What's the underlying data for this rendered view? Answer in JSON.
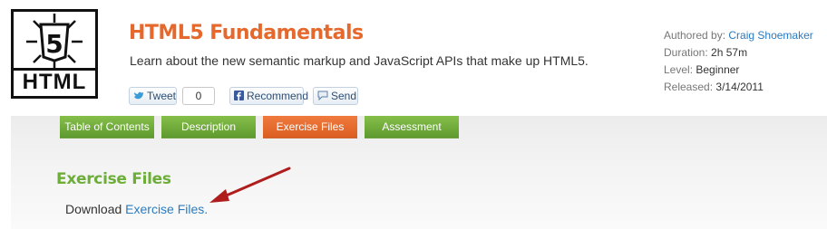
{
  "logo": {
    "badge_digit": "5",
    "wordmark": "HTML"
  },
  "course": {
    "title": "HTML5 Fundamentals",
    "description": "Learn about the new semantic markup and JavaScript APIs that make up HTML5."
  },
  "social": {
    "tweet_label": "Tweet",
    "tweet_count": "0",
    "recommend_label": "Recommend",
    "send_label": "Send"
  },
  "meta": {
    "authored_label": "Authored by:",
    "author": "Craig Shoemaker",
    "duration_label": "Duration:",
    "duration": "2h 57m",
    "level_label": "Level:",
    "level": "Beginner",
    "released_label": "Released:",
    "released": "3/14/2011"
  },
  "tabs": [
    {
      "label": "Table of Contents",
      "state": "inactive"
    },
    {
      "label": "Description",
      "state": "inactive"
    },
    {
      "label": "Exercise Files",
      "state": "active"
    },
    {
      "label": "Assessment",
      "state": "inactive"
    }
  ],
  "content": {
    "heading": "Exercise Files",
    "download_prefix": "Download",
    "download_link": "Exercise Files."
  },
  "colors": {
    "title_orange": "#e5682d",
    "tab_green": "#6ea93a",
    "tab_active_orange": "#e46a2d",
    "section_green": "#6cae38",
    "link_blue": "#2a7bbf",
    "arrow_red": "#b01d1d"
  },
  "icons": {
    "twitter": "twitter-bird-icon",
    "facebook": "facebook-icon",
    "send": "send-speech-bubble-icon",
    "arrow": "red-annotation-arrow"
  }
}
